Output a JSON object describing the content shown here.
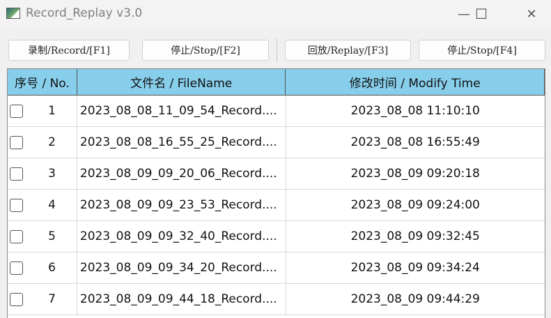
{
  "window": {
    "title": "Record_Replay v3.0",
    "minimize": "—",
    "maximize": "☐",
    "close": "✕"
  },
  "toolbar": {
    "record": "录制/Record/[F1]",
    "stop1": "停止/Stop/[F2]",
    "replay": "回放/Replay/[F3]",
    "stop2": "停止/Stop/[F4]"
  },
  "table": {
    "headers": [
      "序号 / No.",
      "文件名 / FileName",
      "修改时间 / Modify Time"
    ],
    "rows": [
      {
        "no": "1",
        "file": "2023_08_08_11_09_54_Record....",
        "time": "2023_08_08 11:10:10"
      },
      {
        "no": "2",
        "file": "2023_08_08_16_55_25_Record....",
        "time": "2023_08_08 16:55:49"
      },
      {
        "no": "3",
        "file": "2023_08_09_09_20_06_Record....",
        "time": "2023_08_09 09:20:18"
      },
      {
        "no": "4",
        "file": "2023_08_09_09_23_53_Record....",
        "time": "2023_08_09 09:24:00"
      },
      {
        "no": "5",
        "file": "2023_08_09_09_32_40_Record....",
        "time": "2023_08_09 09:32:45"
      },
      {
        "no": "6",
        "file": "2023_08_09_09_34_20_Record....",
        "time": "2023_08_09 09:34:24"
      },
      {
        "no": "7",
        "file": "2023_08_09_09_44_18_Record....",
        "time": "2023_08_09 09:44:29"
      }
    ]
  },
  "colors": {
    "header_bg": "#87ceeb"
  }
}
